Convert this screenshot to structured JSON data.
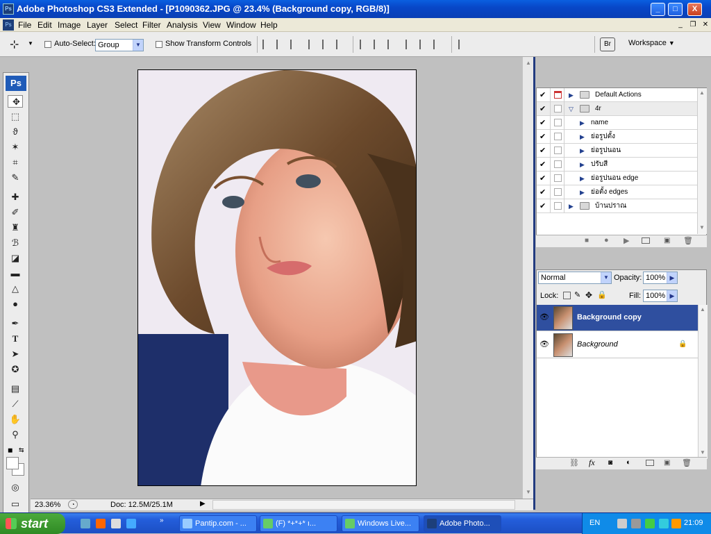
{
  "window": {
    "title": "Adobe Photoshop CS3 Extended - [P1090362.JPG @ 23.4% (Background copy, RGB/8)]",
    "app_icon": "Ps",
    "controls": {
      "minimize": "_",
      "maximize": "□",
      "close": "X"
    }
  },
  "menu": [
    "File",
    "Edit",
    "Image",
    "Layer",
    "Select",
    "Filter",
    "Analysis",
    "View",
    "Window",
    "Help"
  ],
  "options_bar": {
    "auto_select_label": "Auto-Select:",
    "auto_select_checked": false,
    "auto_select_value": "Group",
    "show_transform_label": "Show Transform Controls",
    "show_transform_checked": false,
    "workspace_label": "Workspace"
  },
  "toolbox": {
    "logo": "Ps",
    "tools": [
      "move",
      "marquee",
      "lasso",
      "magic-wand",
      "crop",
      "slice",
      "healing-brush",
      "brush",
      "clone-stamp",
      "history-brush",
      "eraser",
      "gradient",
      "blur",
      "dodge",
      "pen",
      "type",
      "path-selection",
      "shape",
      "notes",
      "eyedropper",
      "hand",
      "zoom"
    ]
  },
  "document": {
    "name": "P1090362.JPG",
    "zoom_display": "23.36%",
    "doc_info": "Doc: 12.5M/25.1M"
  },
  "actions_panel": {
    "items": [
      {
        "label": "Default Actions",
        "type": "set",
        "expanded": false,
        "checked": true,
        "dialog": true
      },
      {
        "label": "4r",
        "type": "set",
        "expanded": true,
        "checked": true,
        "dialog": false
      },
      {
        "label": "name",
        "type": "action",
        "checked": true,
        "dialog": false
      },
      {
        "label": "ย่อรูปตั้ง",
        "type": "action",
        "checked": true,
        "dialog": false
      },
      {
        "label": "ย่อรูปนอน",
        "type": "action",
        "checked": true,
        "dialog": false
      },
      {
        "label": "ปรับสี",
        "type": "action",
        "checked": true,
        "dialog": false
      },
      {
        "label": "ย่อรูปนอน edge",
        "type": "action",
        "checked": true,
        "dialog": false
      },
      {
        "label": "ย่อตั้ง edges",
        "type": "action",
        "checked": true,
        "dialog": false
      },
      {
        "label": "บ้านปราณ",
        "type": "set",
        "expanded": false,
        "checked": true,
        "dialog": false
      }
    ]
  },
  "layers_panel": {
    "blend_mode": "Normal",
    "opacity_label": "Opacity:",
    "opacity_value": "100%",
    "lock_label": "Lock:",
    "fill_label": "Fill:",
    "fill_value": "100%",
    "layers": [
      {
        "name": "Background copy",
        "visible": true,
        "selected": true,
        "locked": false
      },
      {
        "name": "Background",
        "visible": true,
        "selected": false,
        "locked": true
      }
    ]
  },
  "taskbar": {
    "start_label": "start",
    "tasks": [
      {
        "label": "Pantip.com - ...",
        "active": false
      },
      {
        "label": "(F) *+*+* ı...",
        "active": false
      },
      {
        "label": "Windows Live...",
        "active": false
      },
      {
        "label": "Adobe Photo...",
        "active": true
      }
    ],
    "language": "EN",
    "clock": "21:09"
  },
  "colors": {
    "title_blue": "#0a50d8",
    "selected_layer": "#2f4f9f",
    "taskbar_blue": "#245edb",
    "start_green": "#3a9a2f"
  }
}
